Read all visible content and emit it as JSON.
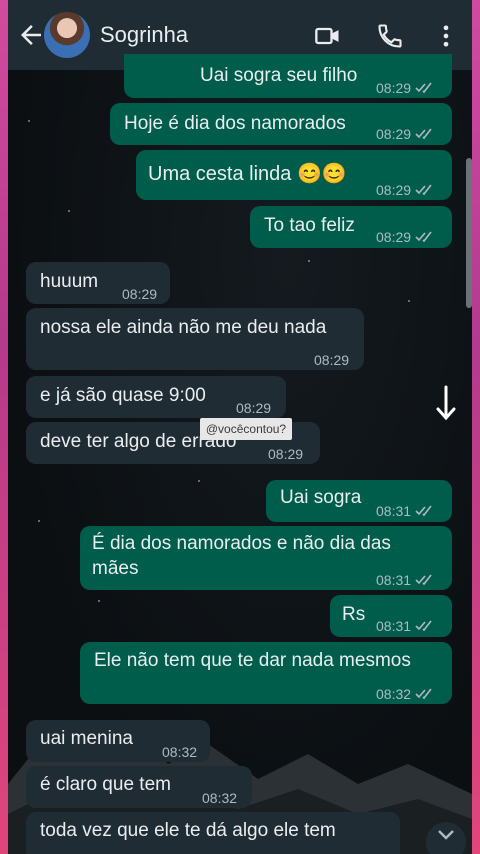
{
  "header": {
    "contact_name": "Sogrinha"
  },
  "watermark": "@vocêcontou?",
  "messages": [
    {
      "text": "Uai sogra seu filho",
      "time": "08:29"
    },
    {
      "text": "Hoje é dia dos namorados",
      "time": "08:29"
    },
    {
      "text": "Uma cesta linda 😊😊",
      "time": "08:29"
    },
    {
      "text": "To tao feliz",
      "time": "08:29"
    },
    {
      "text": "huuum",
      "time": "08:29"
    },
    {
      "text": "nossa ele ainda não me deu nada",
      "time": "08:29"
    },
    {
      "text": "e já são quase 9:00",
      "time": "08:29"
    },
    {
      "text": "deve ter algo de errado",
      "time": "08:29"
    },
    {
      "text": "Uai sogra",
      "time": "08:31"
    },
    {
      "text_line1": "É dia dos namorados e não dia das",
      "text_line2": "mães",
      "time": "08:31"
    },
    {
      "text": "Rs",
      "time": "08:31"
    },
    {
      "text": "Ele não tem que te dar nada mesmos",
      "time": "08:32"
    },
    {
      "text": "uai menina",
      "time": "08:32"
    },
    {
      "text": "é claro que tem",
      "time": "08:32"
    },
    {
      "text": "toda vez que ele te dá algo ele tem"
    }
  ],
  "icons": {
    "back": "arrow-left-icon",
    "video": "video-call-icon",
    "call": "phone-icon",
    "menu": "more-vertical-icon",
    "read": "double-check-icon"
  },
  "colors": {
    "header": "#1f2c34",
    "outgoing": "#005c4b",
    "incoming": "#202c33",
    "frame": "#d24b9e"
  }
}
